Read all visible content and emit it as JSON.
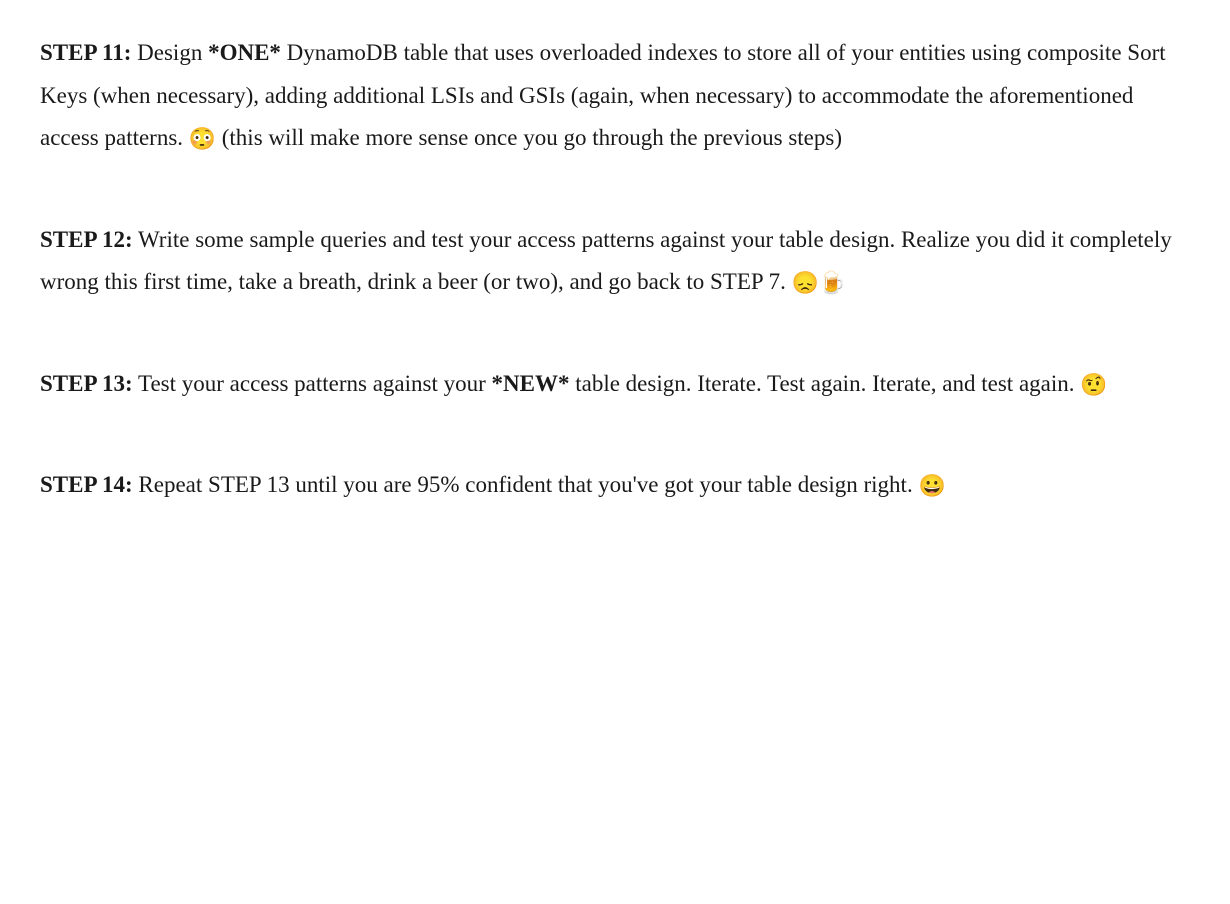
{
  "steps": {
    "s11": {
      "label": "STEP 11:",
      "t1": " Design ",
      "one": "*ONE*",
      "t2": " DynamoDB table that uses overloaded indexes to store all of your entities using composite Sort Keys (when necessary), adding additional LSIs and GSIs (again, when necessary) to accommodate the aforementioned access patterns. ",
      "emoji": "😳",
      "t3": " (this will make more sense once you go through the previous steps)"
    },
    "s12": {
      "label": "STEP 12:",
      "t1": " Write some sample queries and test your access patterns against your table design. Realize you did it completely wrong this first time, take a breath, drink a beer (or two), and go back to STEP 7. ",
      "emoji1": "😞",
      "emoji2": "🍺"
    },
    "s13": {
      "label": "STEP 13:",
      "t1": " Test your access patterns against your ",
      "new": "*NEW*",
      "t2": " table design. Iterate. Test again. Iterate, and test again. ",
      "emoji": "🤨"
    },
    "s14": {
      "label": "STEP 14:",
      "t1": " Repeat STEP 13 until you are 95% confident that you've got your table design right. ",
      "emoji": "😀"
    }
  }
}
